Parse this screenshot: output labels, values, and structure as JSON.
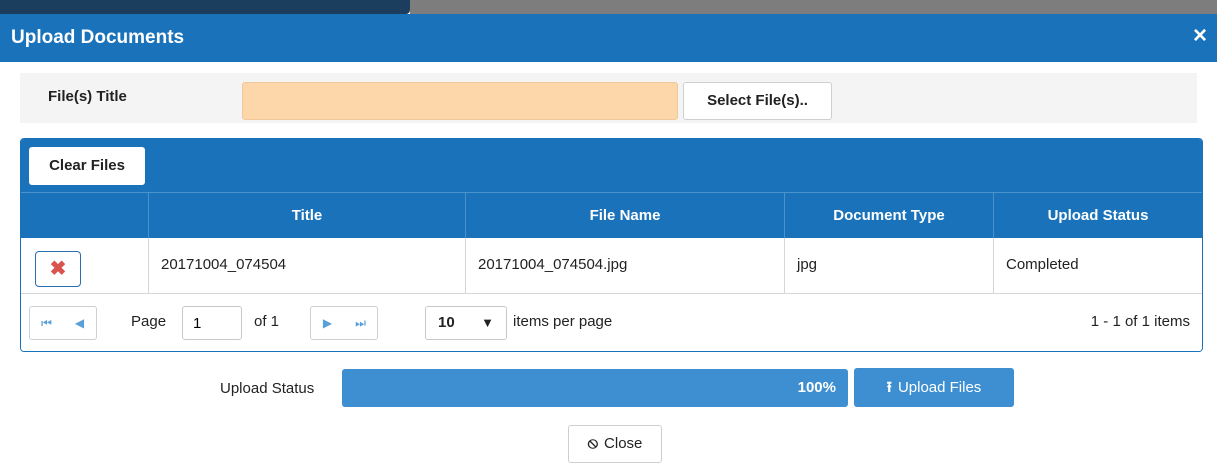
{
  "dialog": {
    "title": "Upload Documents",
    "close_glyph": "×"
  },
  "file_title": {
    "label": "File(s) Title",
    "value": "",
    "select_button": "Select File(s).."
  },
  "grid": {
    "toolbar_button": "Clear Files",
    "columns": [
      "",
      "Title",
      "File Name",
      "Document Type",
      "Upload Status"
    ],
    "rows": [
      {
        "delete_glyph": "✖",
        "title": "20171004_074504",
        "file_name": "20171004_074504.jpg",
        "document_type": "jpg",
        "upload_status": "Completed"
      }
    ],
    "pager": {
      "first_glyph": "⏮",
      "prev_glyph": "◀",
      "next_glyph": "▶",
      "last_glyph": "⏭",
      "page_label": "Page",
      "page_value": "1",
      "of_label": "of 1",
      "page_size": "10",
      "page_size_caret": "▼",
      "items_per_page_label": "items per page",
      "range_text": "1 - 1 of 1 items"
    }
  },
  "upload": {
    "status_label": "Upload Status",
    "progress_percent": 100,
    "progress_text": "100%",
    "button_icon": "⭱",
    "button_label": "Upload Files"
  },
  "footer": {
    "close_icon": "⦸",
    "close_label": "Close"
  },
  "colors": {
    "header_blue": "#1a73ba",
    "progress_blue": "#3d8fd1",
    "input_highlight": "#fdd6aa",
    "delete_red": "#d9534f"
  }
}
